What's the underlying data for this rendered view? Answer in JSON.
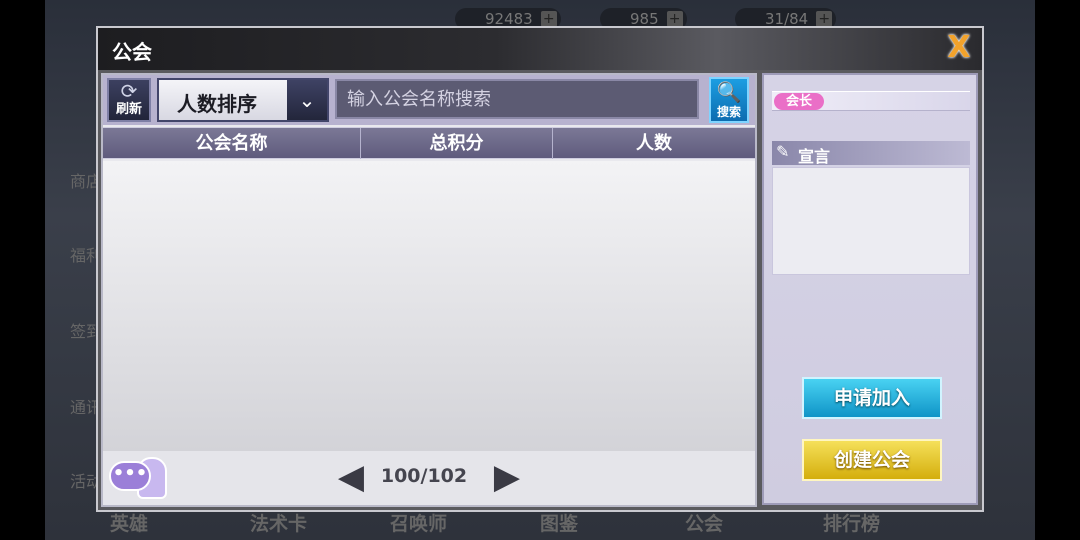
{
  "background": {
    "resources": [
      {
        "value": "92483"
      },
      {
        "value": "985"
      },
      {
        "value": "31/84"
      }
    ],
    "side_labels": [
      "商店",
      "福利",
      "签到",
      "通讯",
      "活动"
    ],
    "bottom_tabs": [
      "英雄",
      "法术卡",
      "召唤师",
      "图鉴",
      "公会",
      "排行榜"
    ]
  },
  "dialog": {
    "title": "公会",
    "close_icon": "X"
  },
  "toolbar": {
    "refresh_icon": "⟳",
    "refresh_label": "刷新",
    "sort_label": "人数排序",
    "sort_arrow": "⌄",
    "search_placeholder": "输入公会名称搜索",
    "search_value": "",
    "search_icon": "🔍",
    "search_label": "搜索"
  },
  "table": {
    "columns": [
      "公会名称",
      "总积分",
      "人数"
    ],
    "rows": []
  },
  "footer": {
    "chat_icon": "•••",
    "prev_icon": "◀",
    "page": "100/102",
    "next_icon": "▶"
  },
  "guild_info": {
    "leader_badge": "会长",
    "declaration_icon": "✎",
    "declaration_title": "宣言",
    "declaration_text": ""
  },
  "actions": {
    "join_label": "申请加入",
    "create_label": "创建公会"
  },
  "colors": {
    "join_button": "#1aa6d6",
    "create_button": "#e6c41e",
    "leader_badge": "#ea6fc7",
    "close_icon": "#f2a22b"
  }
}
